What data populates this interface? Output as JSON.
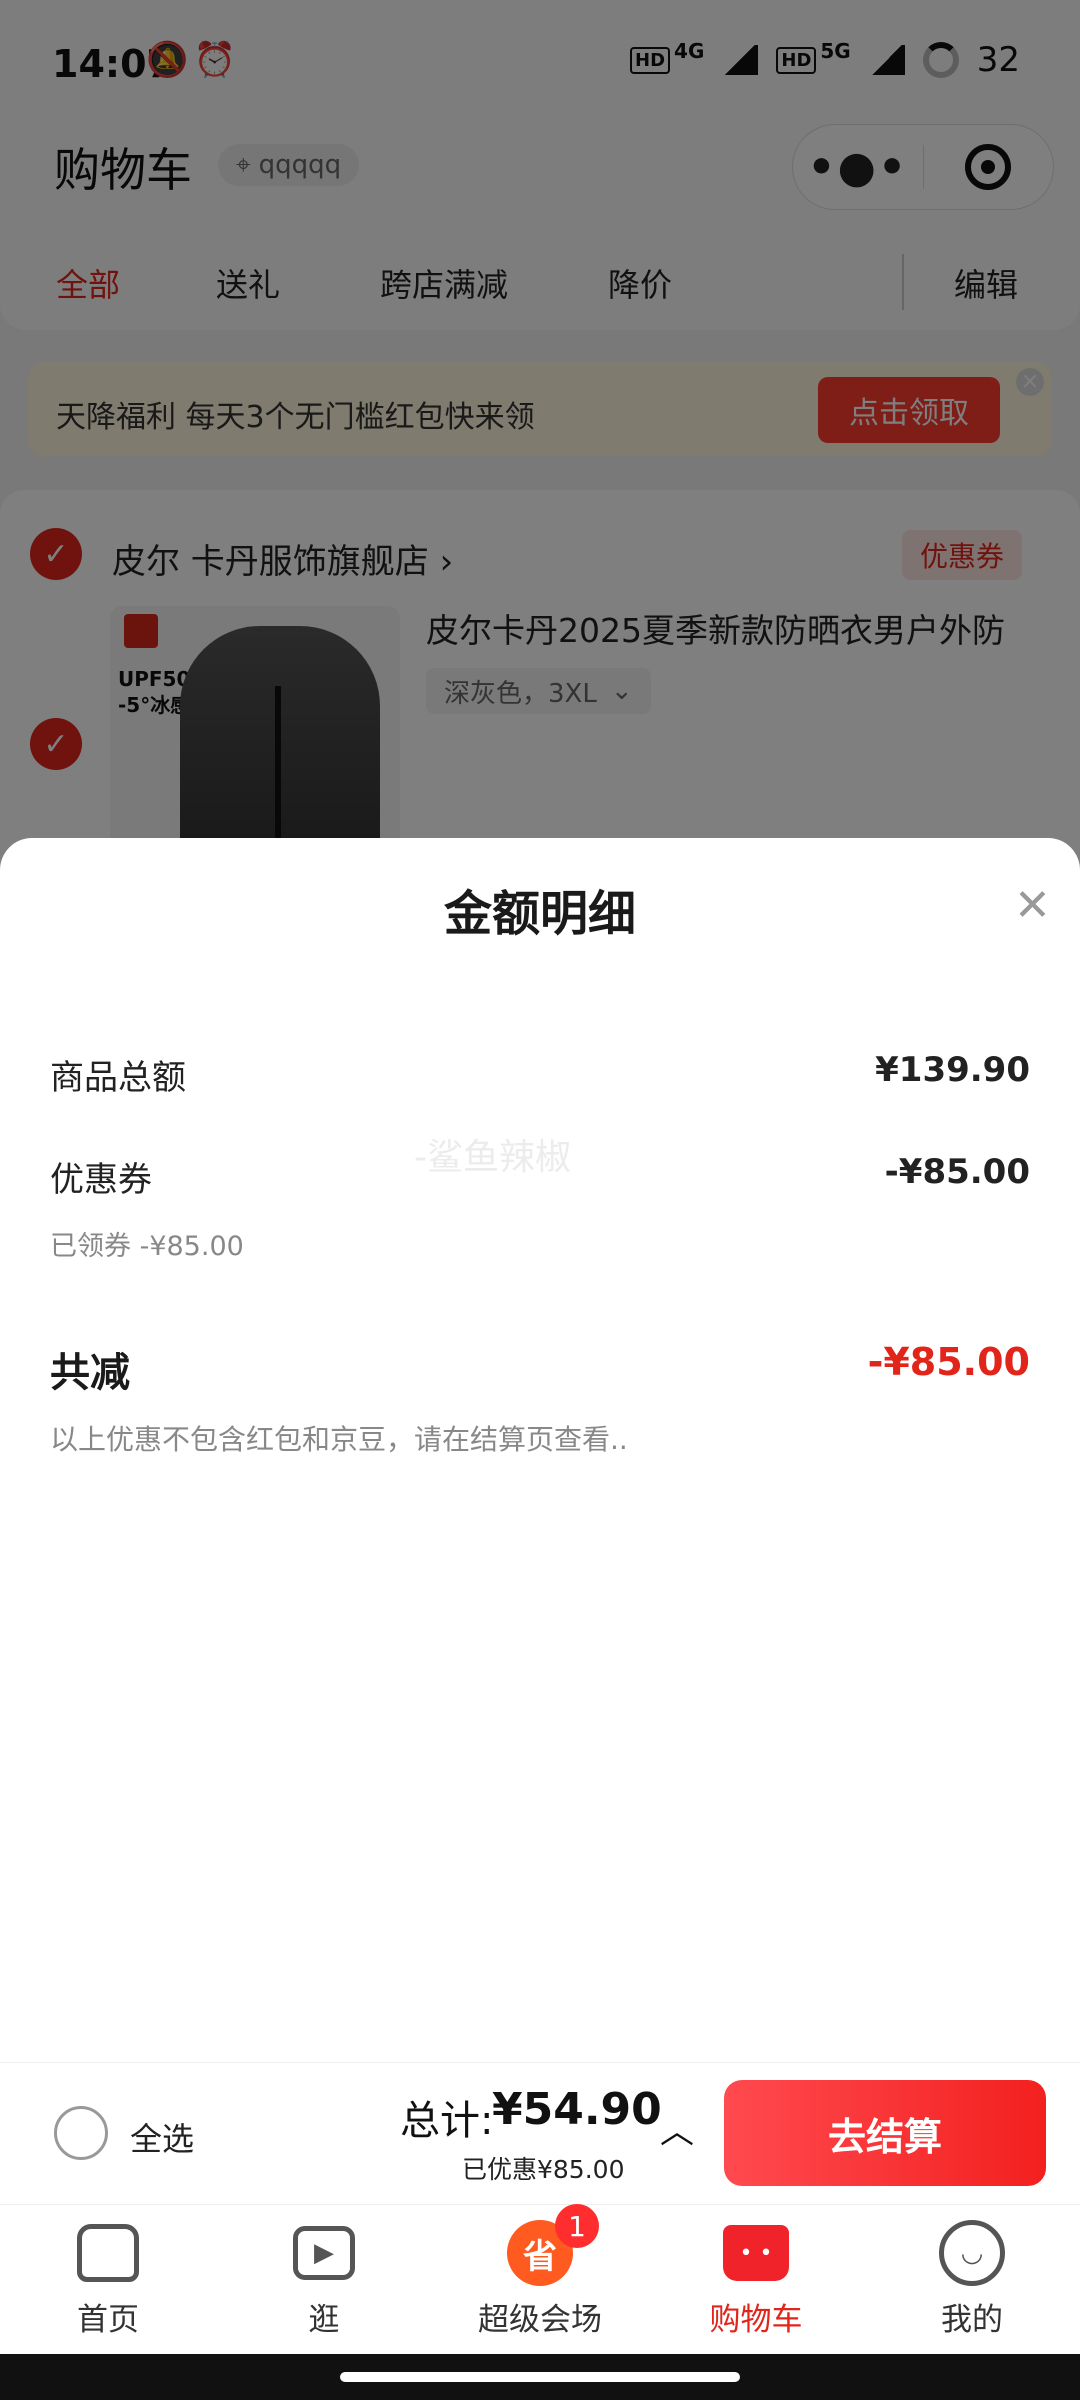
{
  "status_bar": {
    "time": "14:07",
    "left_icons": [
      "mute-bell-icon",
      "alarm-icon"
    ],
    "network": [
      "HD 4G",
      "HD 5G"
    ],
    "battery": "32"
  },
  "header": {
    "title": "购物车",
    "location_chip": "qqqqq",
    "capsule_more": "•●•",
    "capsule_target_icon": "target-icon"
  },
  "tabs": [
    "全部",
    "送礼",
    "跨店满减",
    "降价"
  ],
  "tab_edit": "编辑",
  "banner": {
    "text": "天降福利 每天3个无门槛红包快来领",
    "button": "点击领取"
  },
  "store": {
    "name": "皮尔 卡丹服饰旗舰店 ›",
    "coupon_tag": "优惠券"
  },
  "product": {
    "title": "皮尔卡丹2025夏季新款防晒衣男户外防",
    "spec": "深灰色，3XL",
    "image_text_1": "UPF50+",
    "image_text_2": "-5°冰感"
  },
  "sheet": {
    "title": "金额明细",
    "rows": [
      {
        "label": "商品总额",
        "value": "¥139.90"
      },
      {
        "label": "优惠券",
        "value": "-¥85.00",
        "sub": "已领券 -¥85.00"
      }
    ],
    "total_label": "共减",
    "total_value": "-¥85.00",
    "note": "以上优惠不包含红包和京豆，请在结算页查看..",
    "watermark": "-鲨鱼辣椒"
  },
  "checkout": {
    "select_all": "全选",
    "sum_label": "总计:",
    "sum_value": "¥54.90",
    "saved": "已优惠¥85.00",
    "pay_button": "去结算"
  },
  "bottom_nav": [
    {
      "label": "首页",
      "icon": "home-icon"
    },
    {
      "label": "逛",
      "icon": "play-video-icon"
    },
    {
      "label": "超级会场",
      "icon": "promo-icon",
      "badge": "1"
    },
    {
      "label": "购物车",
      "icon": "cart-icon",
      "active": true
    },
    {
      "label": "我的",
      "icon": "profile-smile-icon"
    }
  ],
  "colors": {
    "accent": "#e1251b",
    "pay_button": "#f3201f",
    "overlay": "rgba(0,0,0,0.5)"
  }
}
